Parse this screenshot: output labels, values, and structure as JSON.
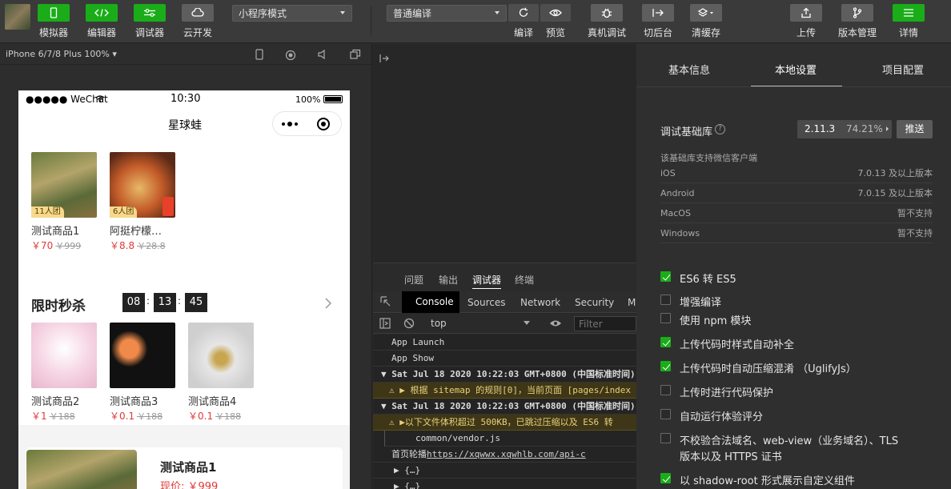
{
  "toolbar": {
    "simulator": "模拟器",
    "editor": "编辑器",
    "debugger": "调试器",
    "cloud": "云开发",
    "mode_select": "小程序模式",
    "compile_select": "普通编译",
    "compile": "编译",
    "preview": "预览",
    "real_debug": "真机调试",
    "background": "切后台",
    "clear_cache": "清缓存",
    "upload": "上传",
    "version": "版本管理",
    "details": "详情"
  },
  "simulator": {
    "device": "iPhone 6/7/8 Plus 100% ▾",
    "status": {
      "carrier": "●●●●● WeChat",
      "time": "10:30",
      "battery": "100%"
    },
    "nav_title": "星球蛙",
    "group_products": [
      {
        "name": "测试商品1",
        "price": "￥70",
        "orig": "￥999",
        "tag": "11人团"
      },
      {
        "name": "阿挺柠檬…",
        "price": "￥8.8",
        "orig": "￥28.8",
        "tag": "6人团"
      }
    ],
    "flash": {
      "title": "限时秒杀",
      "hh": "08",
      "mm": "13",
      "ss": "45",
      "sep": ":"
    },
    "flash_products": [
      {
        "name": "测试商品2",
        "price": "￥1",
        "orig": "￥188"
      },
      {
        "name": "测试商品3",
        "price": "￥0.1",
        "orig": "￥188"
      },
      {
        "name": "测试商品4",
        "price": "￥0.1",
        "orig": "￥188"
      }
    ],
    "bottom_card": {
      "name": "测试商品1",
      "price_label": "现价: ￥999"
    }
  },
  "devtools": {
    "panel_tabs": [
      "问题",
      "输出",
      "调试器",
      "终端"
    ],
    "active_panel": "调试器",
    "tool_tabs": [
      "Console",
      "Sources",
      "Network",
      "Security",
      "M"
    ],
    "context": "top",
    "filter_placeholder": "Filter",
    "console": [
      {
        "text": "App Launch",
        "kind": "log"
      },
      {
        "text": "App Show",
        "kind": "log"
      },
      {
        "text": "▼ Sat Jul 18 2020 10:22:03 GMT+0800 (中国标准时间)",
        "kind": "group"
      },
      {
        "text": "⚠ ▶ 根据 sitemap 的规则[0]，当前页面 [pages/index",
        "kind": "warn"
      },
      {
        "text": "▼ Sat Jul 18 2020 10:22:03 GMT+0800 (中国标准时间)",
        "kind": "group"
      },
      {
        "text": "⚠ ▶以下文件体积超过 500KB，已跳过压缩以及 ES6 转",
        "kind": "warn"
      },
      {
        "text": "common/vendor.js",
        "kind": "sub"
      },
      {
        "text": "首页轮播",
        "kind": "link",
        "link": "https://xqwwx.xqwhlb.com/api-c"
      },
      {
        "text": "▶ {…}",
        "kind": "sub"
      },
      {
        "text": "▶ {…}",
        "kind": "sub"
      }
    ]
  },
  "details": {
    "tabs": [
      "基本信息",
      "本地设置",
      "项目配置"
    ],
    "active_tab": "本地设置",
    "base_lib_label": "调试基础库",
    "base_lib_version": "2.11.3",
    "base_lib_percent": "74.21%",
    "push": "推送",
    "support_note": "该基础库支持微信客户端",
    "platforms": [
      {
        "os": "iOS",
        "ver": "7.0.13 及以上版本"
      },
      {
        "os": "Android",
        "ver": "7.0.15 及以上版本"
      },
      {
        "os": "MacOS",
        "ver": "暂不支持"
      },
      {
        "os": "Windows",
        "ver": "暂不支持"
      }
    ],
    "options": [
      {
        "label": "ES6 转 ES5",
        "checked": true
      },
      {
        "label": "增强编译",
        "checked": false
      },
      {
        "label": "使用 npm 模块",
        "checked": false
      },
      {
        "label": "上传代码时样式自动补全",
        "checked": true
      },
      {
        "label": "上传代码时自动压缩混淆 （UglifyJs）",
        "checked": true
      },
      {
        "label": "上传时进行代码保护",
        "checked": false
      },
      {
        "label": "自动运行体验评分",
        "checked": false
      },
      {
        "label": "不校验合法域名、web-view（业务域名）、TLS",
        "label2": "版本以及 HTTPS 证书",
        "checked": false
      },
      {
        "label": "以 shadow-root 形式展示自定义组件",
        "checked": true
      }
    ]
  },
  "colors": {
    "accent": "#1aad19",
    "price": "#e03a3a"
  }
}
